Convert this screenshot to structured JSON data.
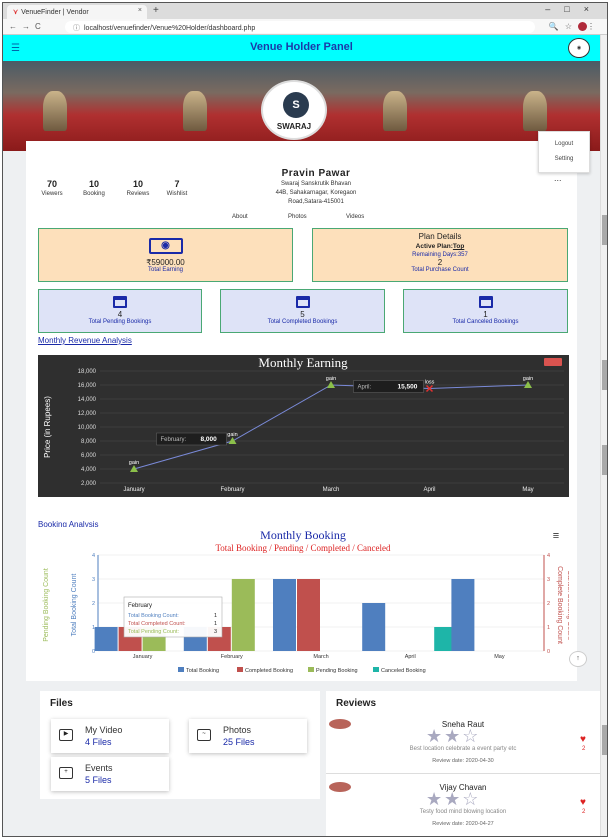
{
  "browser": {
    "tab_title": "VenueFinder | Vendor",
    "url": "localhost/venuefinder/Venue%20Holder/dashboard.php"
  },
  "header": {
    "title": "Venue Holder Panel"
  },
  "logo": {
    "text": "SWARAJ",
    "mark": "S"
  },
  "menu": {
    "logout": "Logout",
    "setting": "Setting"
  },
  "stats": [
    {
      "value": "70",
      "label": "Viewers"
    },
    {
      "value": "10",
      "label": "Booking"
    },
    {
      "value": "10",
      "label": "Reviews"
    },
    {
      "value": "7",
      "label": "Wishlist"
    }
  ],
  "profile": {
    "name": "Pravin Pawar",
    "venue": "Swaraj Sanskrutik Bhavan",
    "address1": "44B, Sahakarnagar, Koregaon",
    "address2": "Road,Satara-415001",
    "more": "..."
  },
  "profile_tabs": [
    "About",
    "Photos",
    "Videos"
  ],
  "earning_card": {
    "value": "₹59000.00",
    "label": "Total Earning",
    "icon": "money-icon"
  },
  "plan_card": {
    "title": "Plan Details",
    "active_label": "Active Plan:",
    "active_value": "Top",
    "remaining": "Remaining Days:357",
    "count": "2",
    "count_label": "Total Purchase Count"
  },
  "booking_cards": [
    {
      "value": "4",
      "label": "Total Pending Bookings"
    },
    {
      "value": "5",
      "label": "Total Completed Bookings"
    },
    {
      "value": "1",
      "label": "Total Canceled Bookings"
    }
  ],
  "sections": {
    "revenue": "Monthly Revenue Analysis",
    "booking": "Booking Analysis"
  },
  "files": {
    "title": "Files",
    "items": [
      {
        "name": "My Video",
        "count": "4 Files",
        "icon": "video-icon"
      },
      {
        "name": "Photos",
        "count": "25 Files",
        "icon": "image-icon"
      },
      {
        "name": "Events",
        "count": "5 Files",
        "icon": "gift-icon"
      }
    ]
  },
  "reviews": {
    "title": "Reviews",
    "items": [
      {
        "name": "Sneha Raut",
        "rating": 2.5,
        "text": "Best location celebrate a event party etc",
        "date": "Review date: 2020-04-30",
        "likes": "2"
      },
      {
        "name": "Vijay Chavan",
        "rating": 2.5,
        "text": "Testy food mind blowing location",
        "date": "Review date: 2020-04-27",
        "likes": "2"
      }
    ]
  },
  "colors": {
    "header_bg": "#00ffff",
    "accent": "#1a3aa8",
    "card_orange": "#fde0bb",
    "card_blue": "#dee3f7"
  },
  "chart_data": [
    {
      "type": "line",
      "title": "Monthly Earning",
      "ylabel": "Price (in Rupees)",
      "categories": [
        "January",
        "February",
        "March",
        "April",
        "May"
      ],
      "values": [
        4000,
        8000,
        16000,
        15500,
        16000
      ],
      "point_labels": [
        "gain",
        "gain",
        "gain",
        "loss",
        "gain"
      ],
      "ylim": [
        2000,
        18000
      ],
      "yticks": [
        "2,000",
        "4,000",
        "6,000",
        "8,000",
        "10,000",
        "12,000",
        "14,000",
        "16,000",
        "18,000"
      ],
      "tooltips": [
        {
          "category": "February",
          "label": "February:",
          "value": "8,000"
        },
        {
          "category": "April",
          "label": "April:",
          "value": "15,500"
        }
      ]
    },
    {
      "type": "bar",
      "title": "Monthly Booking",
      "subtitle": "Total Booking / Pending / Completed / Canceled",
      "categories": [
        "January",
        "February",
        "March",
        "April",
        "May"
      ],
      "ylabel_left_outer": "Pending Booking Count",
      "ylabel_left_inner": "Total Booking Count",
      "ylabel_right_inner": "Complete Booking Count",
      "ylabel_right_outer": "Cancel Booking Count",
      "ylim": [
        0,
        4
      ],
      "yticks": [
        "0",
        "1",
        "2",
        "3",
        "4"
      ],
      "series": [
        {
          "name": "Total Booking",
          "color": "#4f7fbf",
          "values": [
            1,
            1,
            3,
            2,
            3
          ]
        },
        {
          "name": "Completed Booking",
          "color": "#c0504d",
          "values": [
            1,
            1,
            3,
            0,
            0
          ]
        },
        {
          "name": "Pending Booking",
          "color": "#9bbb59",
          "values": [
            1,
            3,
            0,
            0,
            0
          ]
        },
        {
          "name": "Canceled Booking",
          "color": "#1eb5a8",
          "values": [
            0,
            0,
            0,
            1,
            0
          ]
        }
      ],
      "tooltip": {
        "title": "February",
        "rows": [
          {
            "label": "Total Booking Count:",
            "value": "1"
          },
          {
            "label": "Total Completed Count:",
            "value": "1"
          },
          {
            "label": "Total Pending Count:",
            "value": "3"
          }
        ]
      }
    }
  ]
}
